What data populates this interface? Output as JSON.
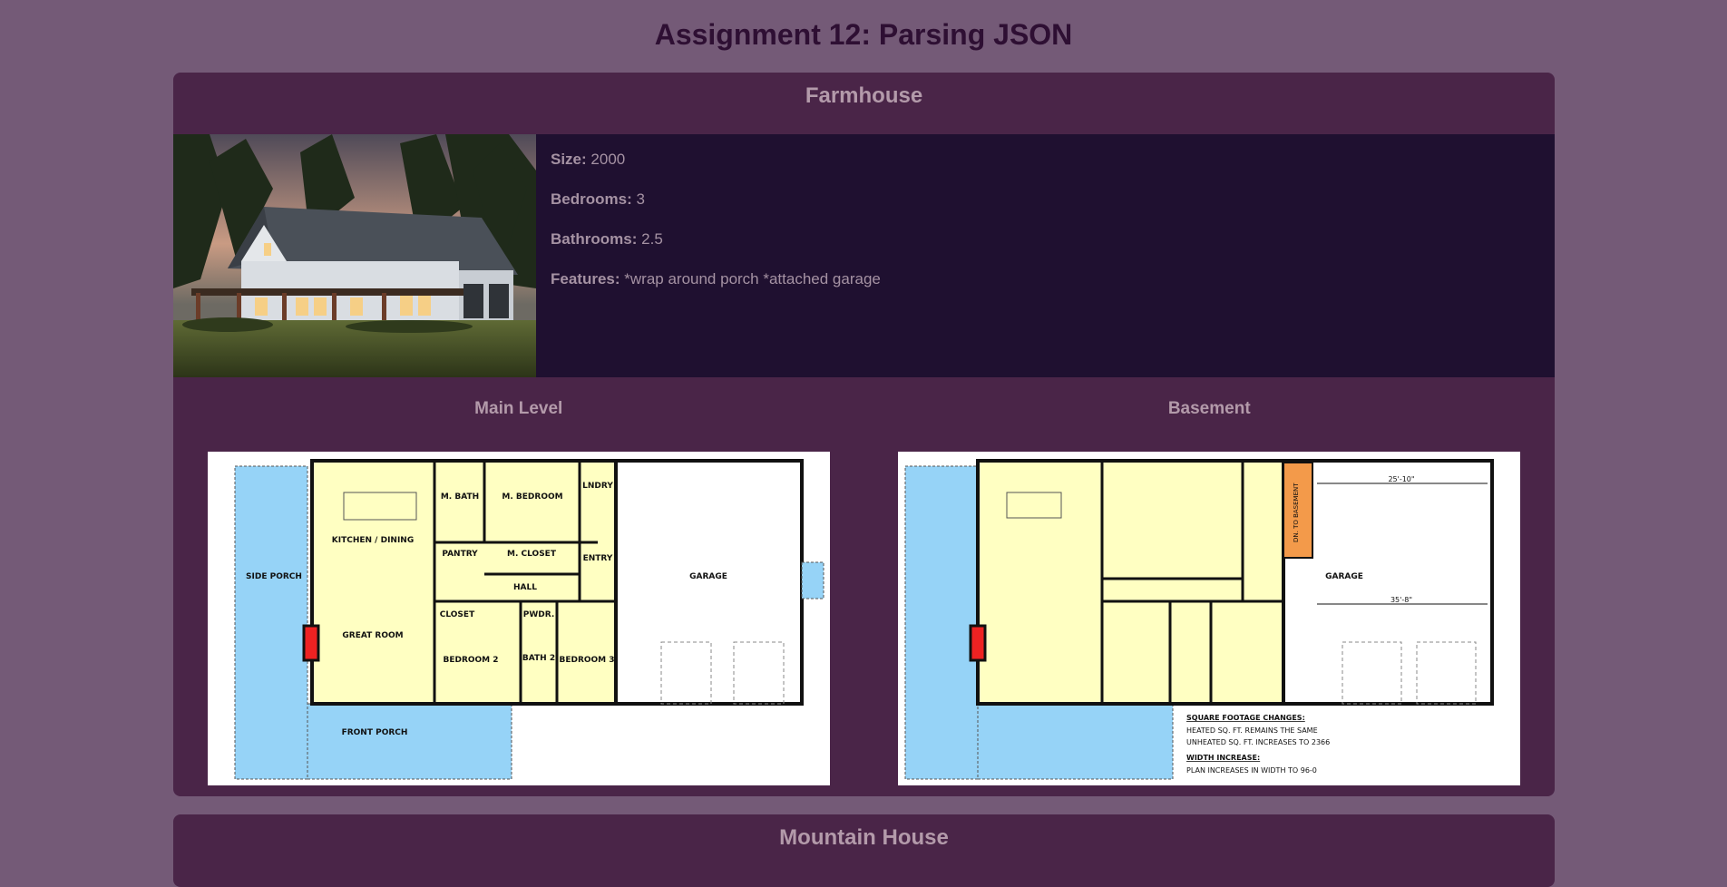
{
  "page": {
    "title": "Assignment 12: Parsing JSON"
  },
  "houses": [
    {
      "name": "Farmhouse",
      "size_label": "Size:",
      "size": "2000",
      "bedrooms_label": "Bedrooms:",
      "bedrooms": "3",
      "bathrooms_label": "Bathrooms:",
      "bathrooms": "2.5",
      "features_label": "Features:",
      "features": "*wrap around porch *attached garage",
      "floor_plans": [
        {
          "label": "Main Level",
          "rooms": {
            "side_porch": "SIDE PORCH",
            "kitchen": "KITCHEN / DINING",
            "great_room": "GREAT ROOM",
            "m_bath": "M. BATH",
            "m_bedroom": "M. BEDROOM",
            "pantry": "PANTRY",
            "m_closet": "M. CLOSET",
            "entry": "ENTRY",
            "lndry": "LNDRY",
            "hall": "HALL",
            "closet": "CLOSET",
            "pwdr": "PWDR.",
            "bedroom2": "BEDROOM 2",
            "bath2": "BATH 2",
            "bedroom3": "BEDROOM 3",
            "garage": "GARAGE",
            "front_porch": "FRONT PORCH"
          }
        },
        {
          "label": "Basement",
          "rooms": {
            "garage": "GARAGE",
            "to_basement": "DN. TO BASEMENT",
            "dim_top": "25'-10\"",
            "dim_mid": "35'-8\"",
            "sq_heading": "SQUARE FOOTAGE CHANGES:",
            "sq_line1": "HEATED SQ. FT. REMAINS THE SAME",
            "sq_line2": "UNHEATED SQ. FT. INCREASES TO 2366",
            "width_heading": "WIDTH INCREASE:",
            "width_line": "PLAN INCREASES IN WIDTH TO 96-0"
          }
        }
      ]
    },
    {
      "name": "Mountain House"
    }
  ],
  "colors": {
    "background": "#745a77",
    "card": "#4a2548",
    "info_panel": "#1f1030",
    "heading_text": "#2e0f33",
    "muted_text": "#b39aaa",
    "porch_blue": "#96d3f7",
    "room_yellow": "#ffffc2",
    "stair_orange": "#f39a4a"
  }
}
